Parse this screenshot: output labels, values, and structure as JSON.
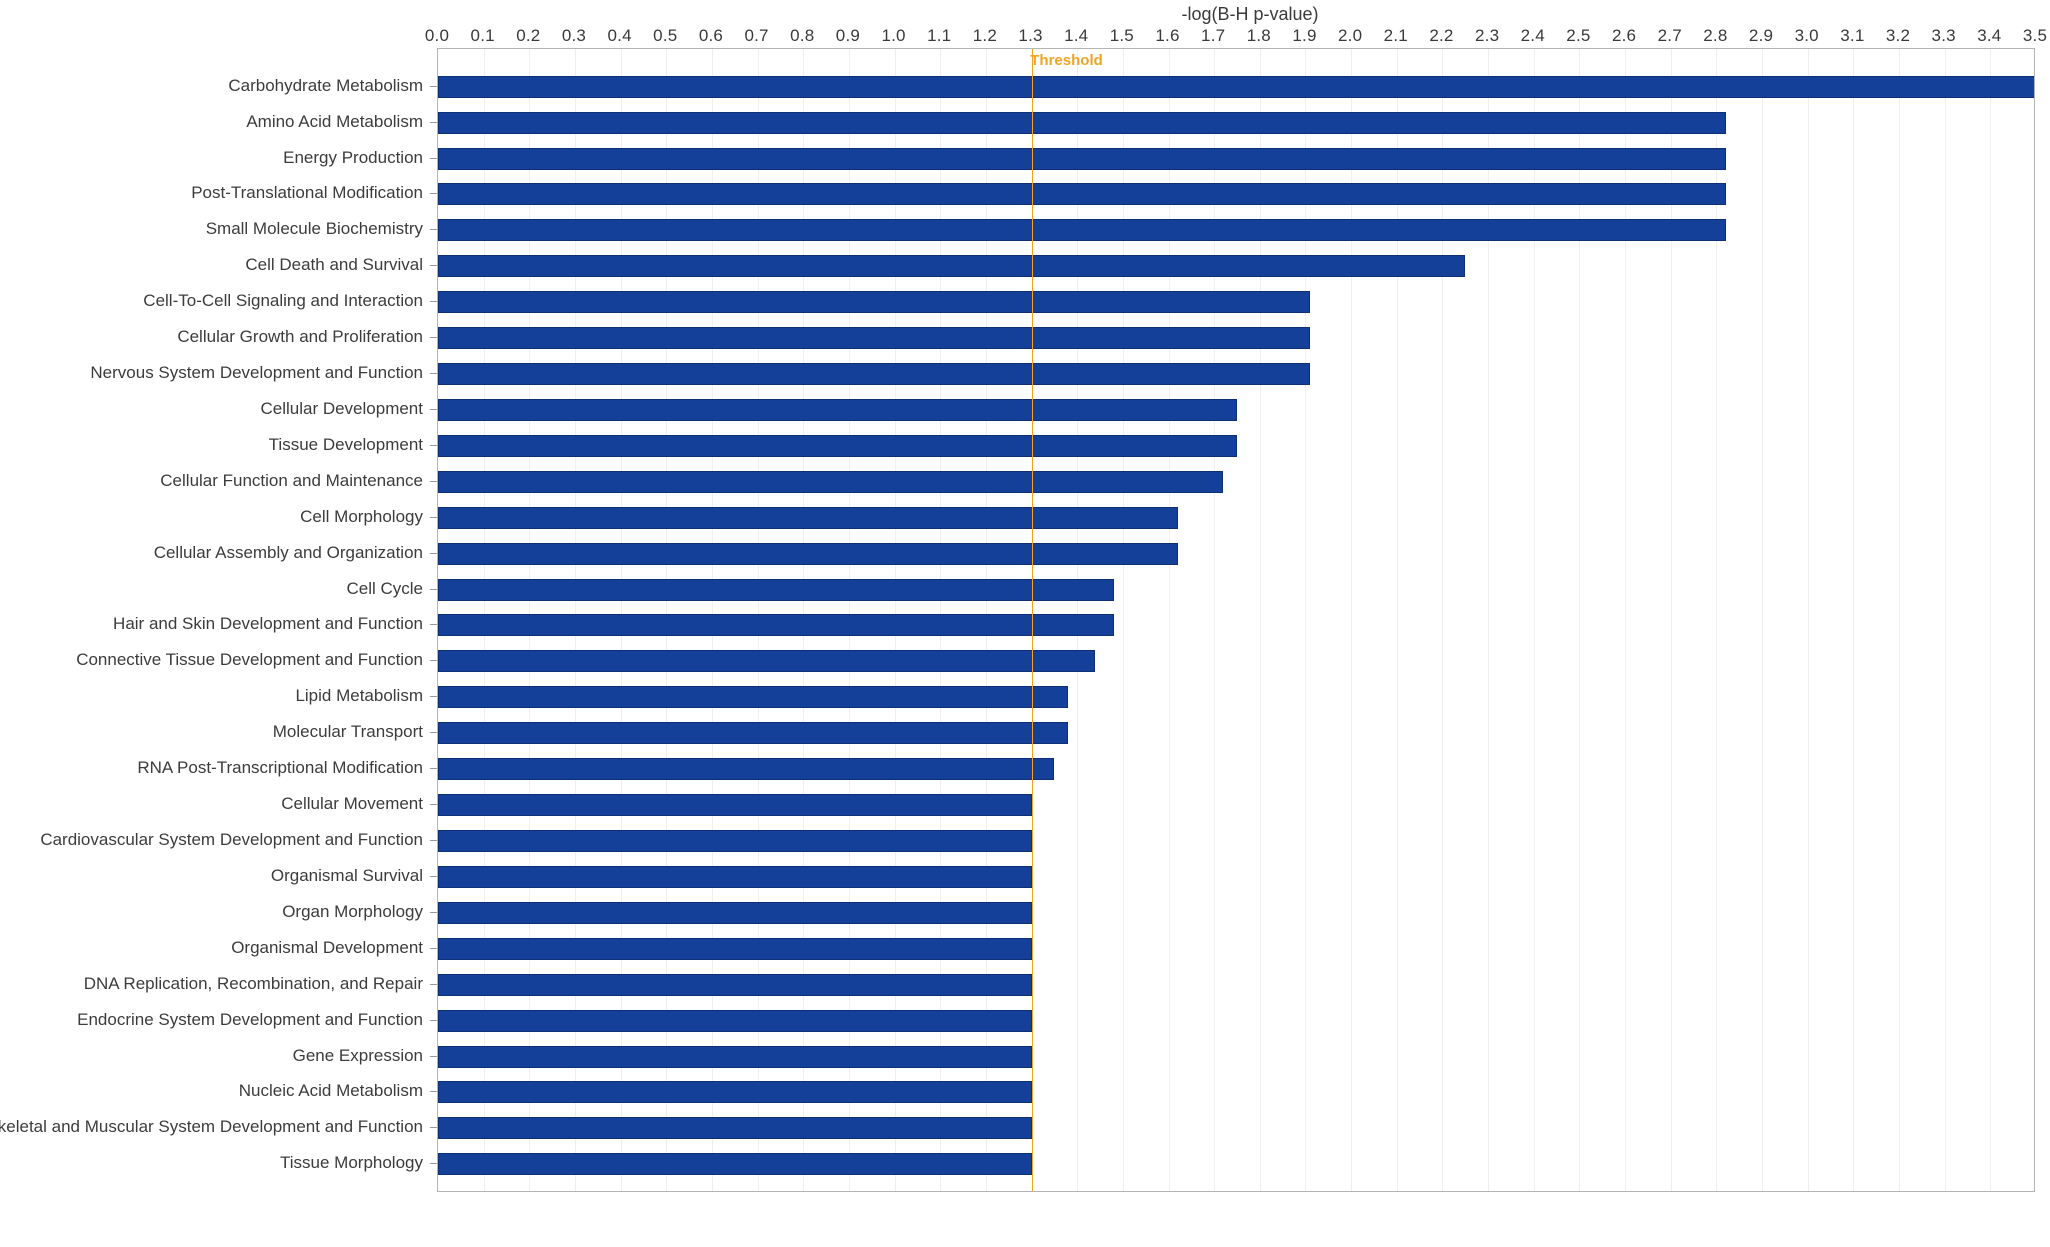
{
  "chart_data": {
    "type": "bar",
    "orientation": "horizontal",
    "title": "-log(B-H p-value)",
    "xlabel": "-log(B-H p-value)",
    "ylabel": "",
    "xlim": [
      0.0,
      3.5
    ],
    "xticks": [
      "0.0",
      "0.1",
      "0.2",
      "0.3",
      "0.4",
      "0.5",
      "0.6",
      "0.7",
      "0.8",
      "0.9",
      "1.0",
      "1.1",
      "1.2",
      "1.3",
      "1.4",
      "1.5",
      "1.6",
      "1.7",
      "1.8",
      "1.9",
      "2.0",
      "2.1",
      "2.2",
      "2.3",
      "2.4",
      "2.5",
      "2.6",
      "2.7",
      "2.8",
      "2.9",
      "3.0",
      "3.1",
      "3.2",
      "3.3",
      "3.4",
      "3.5"
    ],
    "xtick_values": [
      0.0,
      0.1,
      0.2,
      0.3,
      0.4,
      0.5,
      0.6,
      0.7,
      0.8,
      0.9,
      1.0,
      1.1,
      1.2,
      1.3,
      1.4,
      1.5,
      1.6,
      1.7,
      1.8,
      1.9,
      2.0,
      2.1,
      2.2,
      2.3,
      2.4,
      2.5,
      2.6,
      2.7,
      2.8,
      2.9,
      3.0,
      3.1,
      3.2,
      3.3,
      3.4,
      3.5
    ],
    "grid": true,
    "grid_axis": "x",
    "legend": false,
    "bar_color": "#14409A",
    "bar_edge_color": "#0D2F73",
    "threshold": {
      "label": "Threshold",
      "value": 1.3,
      "color": "#F0A427"
    },
    "categories": [
      "Carbohydrate Metabolism",
      "Amino Acid Metabolism",
      "Energy Production",
      "Post-Translational Modification",
      "Small Molecule Biochemistry",
      "Cell Death and Survival",
      "Cell-To-Cell Signaling and Interaction",
      "Cellular Growth and Proliferation",
      "Nervous System Development and Function",
      "Cellular Development",
      "Tissue Development",
      "Cellular Function and Maintenance",
      "Cell Morphology",
      "Cellular Assembly and Organization",
      "Cell Cycle",
      "Hair and Skin Development and Function",
      "Connective Tissue Development and Function",
      "Lipid Metabolism",
      "Molecular Transport",
      "RNA Post-Transcriptional Modification",
      "Cellular Movement",
      "Cardiovascular System Development and Function",
      "Organismal Survival",
      "Organ Morphology",
      "Organismal Development",
      "DNA Replication, Recombination, and Repair",
      "Endocrine System Development and Function",
      "Gene Expression",
      "Nucleic Acid Metabolism",
      "Skeletal and Muscular System Development and Function",
      "Tissue Morphology"
    ],
    "values": [
      3.5,
      2.82,
      2.82,
      2.82,
      2.82,
      2.25,
      1.91,
      1.91,
      1.91,
      1.75,
      1.75,
      1.72,
      1.62,
      1.62,
      1.48,
      1.48,
      1.44,
      1.38,
      1.38,
      1.35,
      1.3,
      1.3,
      1.3,
      1.3,
      1.3,
      1.3,
      1.3,
      1.3,
      1.3,
      1.3,
      1.3
    ]
  }
}
